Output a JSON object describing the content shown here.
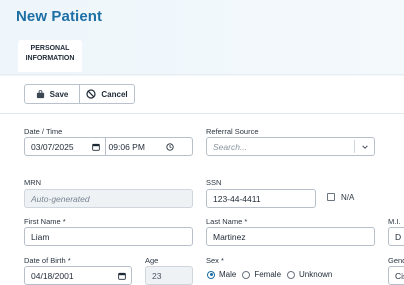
{
  "header": {
    "title": "New Patient",
    "tabs": [
      {
        "label": "PERSONAL INFORMATION"
      }
    ]
  },
  "toolbar": {
    "save_label": "Save",
    "cancel_label": "Cancel"
  },
  "form": {
    "date_time": {
      "label": "Date / Time",
      "date": "03/07/2025",
      "time": "09:06 PM"
    },
    "referral_source": {
      "label": "Referral Source",
      "placeholder": "Search..."
    },
    "mrn": {
      "label": "MRN",
      "placeholder": "Auto-generated"
    },
    "ssn": {
      "label": "SSN",
      "value": "123-44-4411",
      "na_label": "N/A",
      "na_checked": false
    },
    "first_name": {
      "label": "First Name *",
      "value": "Liam"
    },
    "last_name": {
      "label": "Last Name *",
      "value": "Martinez"
    },
    "middle_initial": {
      "label": "M.I.",
      "value": "D"
    },
    "date_of_birth": {
      "label": "Date of Birth *",
      "value": "04/18/2001"
    },
    "age": {
      "label": "Age",
      "value": "23"
    },
    "sex": {
      "label": "Sex *",
      "options": [
        "Male",
        "Female",
        "Unknown"
      ],
      "selected": "Male"
    },
    "gender": {
      "label": "Gend",
      "value": "Cis"
    }
  },
  "colors": {
    "accent": "#1d6fa5",
    "border": "#b7c0ca"
  }
}
